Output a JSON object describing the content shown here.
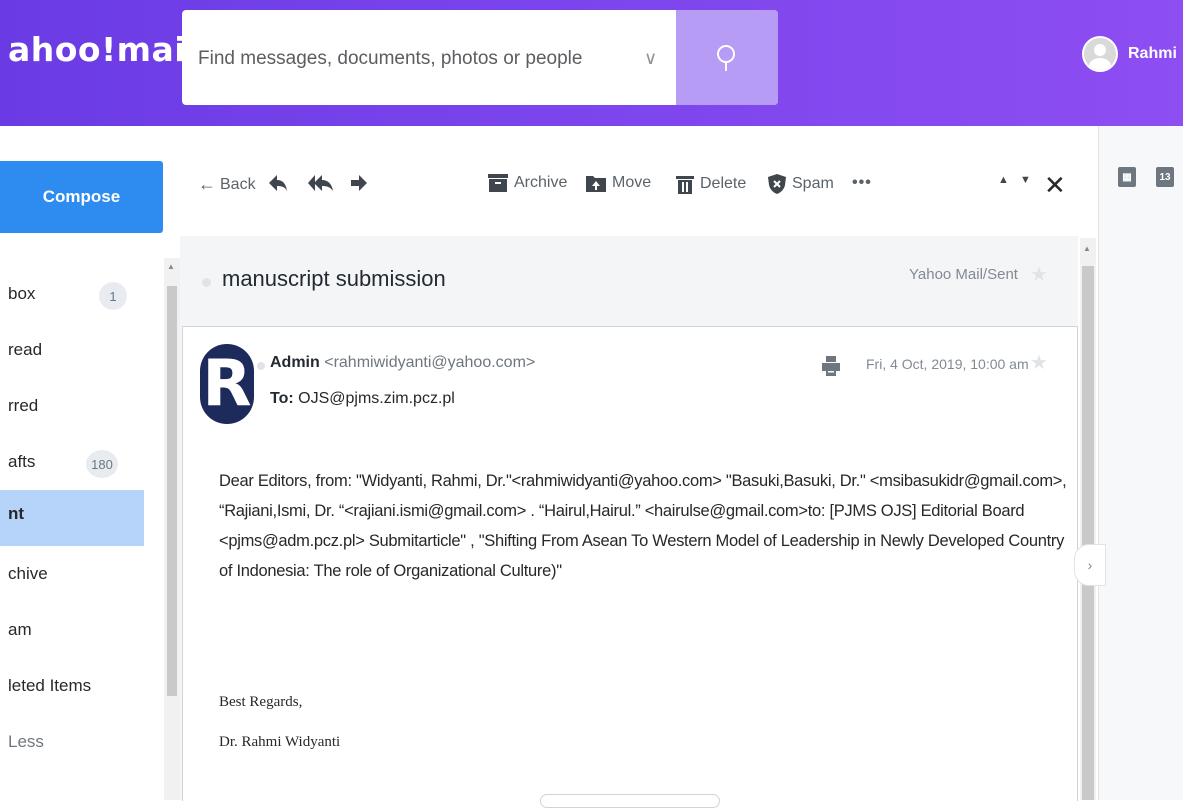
{
  "app": {
    "logo": "ahoo!mail"
  },
  "search": {
    "placeholder": "Find messages, documents, photos or people"
  },
  "user": {
    "name": "Rahmi"
  },
  "compose": {
    "label": "Compose"
  },
  "sidebar": {
    "items": [
      {
        "label": "box",
        "count": "1"
      },
      {
        "label": "read",
        "count": ""
      },
      {
        "label": "rred",
        "count": ""
      },
      {
        "label": "afts",
        "count": "180"
      },
      {
        "label": "nt",
        "count": ""
      },
      {
        "label": "chive",
        "count": ""
      },
      {
        "label": "am",
        "count": ""
      },
      {
        "label": "leted Items",
        "count": ""
      },
      {
        "label": "Less",
        "count": ""
      }
    ]
  },
  "toolbar": {
    "back": "Back",
    "archive": "Archive",
    "move": "Move",
    "delete": "Delete",
    "spam": "Spam",
    "more": "•••"
  },
  "message": {
    "subject": "manuscript submission",
    "folder": "Yahoo Mail/Sent",
    "sender_name": "Admin",
    "sender_email": "<rahmiwidyanti@yahoo.com>",
    "to_label": "To:",
    "to": "OJS@pjms.zim.pcz.pl",
    "date": "Fri, 4 Oct, 2019, 10:00 am",
    "avatar_letter": "R",
    "body": "Dear Editors, from: \"Widyanti, Rahmi, Dr.\"<rahmiwidyanti@yahoo.com> \"Basuki,Basuki, Dr.\" <msibasukidr@gmail.com>, “Rajiani,Ismi, Dr. “<rajiani.ismi@gmail.com> . “Hairul,Hairul.” <hairulse@gmail.com>to: [PJMS OJS] Editorial Board <pjms@adm.pcz.pl> Submitarticle\" , \"Shifting From Asean To Western Model of Leadership in Newly Developed Country of Indonesia: The role of Organizational Culture)\"",
    "signoff": "Best Regards,",
    "signature": "Dr. Rahmi Widyanti"
  },
  "right_panel": {
    "calendar_day": "13"
  },
  "colors": {
    "header": "#7b44ec",
    "compose": "#2e8cf0",
    "active_nav": "#b6d4fa"
  }
}
